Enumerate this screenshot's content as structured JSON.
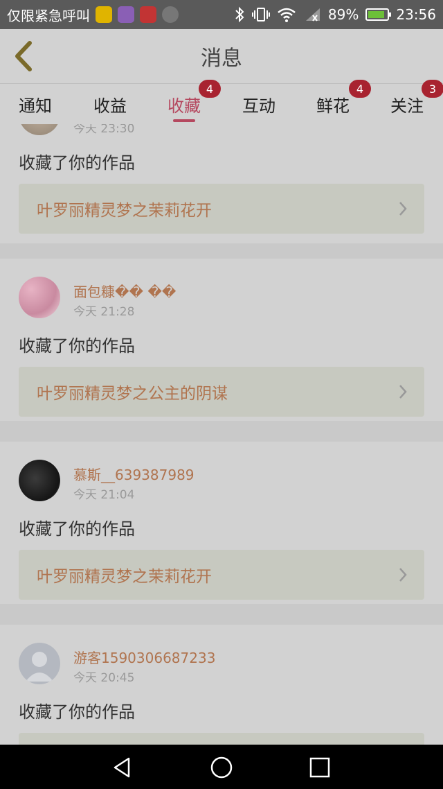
{
  "statusbar": {
    "carrier": "仅限紧急呼叫",
    "battery_pct": "89%",
    "time": "23:56",
    "battery_level": 0.89,
    "app_icons": [
      "beetle-app-icon",
      "gallery-app-icon",
      "weibo-app-icon",
      "drawing-app-icon"
    ],
    "status_icons": [
      "bluetooth-icon",
      "vibrate-icon",
      "wifi-icon",
      "signal-icon",
      "battery-icon"
    ]
  },
  "header": {
    "title": "消息",
    "back_icon": "back-chevron-icon"
  },
  "tabs": [
    {
      "label": "通知",
      "badge": ""
    },
    {
      "label": "收益",
      "badge": ""
    },
    {
      "label": "收藏",
      "badge": "4",
      "active": true
    },
    {
      "label": "互动",
      "badge": ""
    },
    {
      "label": "鲜花",
      "badge": "4"
    },
    {
      "label": "关注",
      "badge": "3"
    }
  ],
  "items": [
    {
      "username": "",
      "time": "今天 23:30",
      "action": "收藏了你的作品",
      "work_title": "叶罗丽精灵梦之茉莉花开"
    },
    {
      "username": "面包糠�� ��",
      "time": "今天 21:28",
      "action": "收藏了你的作品",
      "work_title": "叶罗丽精灵梦之公主的阴谋"
    },
    {
      "username": "慕斯__639387989",
      "time": "今天 21:04",
      "action": "收藏了你的作品",
      "work_title": "叶罗丽精灵梦之茉莉花开"
    },
    {
      "username": "游客1590306687233",
      "time": "今天 20:45",
      "action": "收藏了你的作品",
      "work_title": ""
    }
  ],
  "colors": {
    "accent": "#b5485f",
    "badge": "#a82330",
    "link": "#b0744f",
    "work_bg": "#c7c9c0",
    "overlay_bg": "#d2d2d2"
  },
  "navbar": {
    "icons": [
      "back-triangle-icon",
      "home-circle-icon",
      "recents-square-icon"
    ]
  }
}
